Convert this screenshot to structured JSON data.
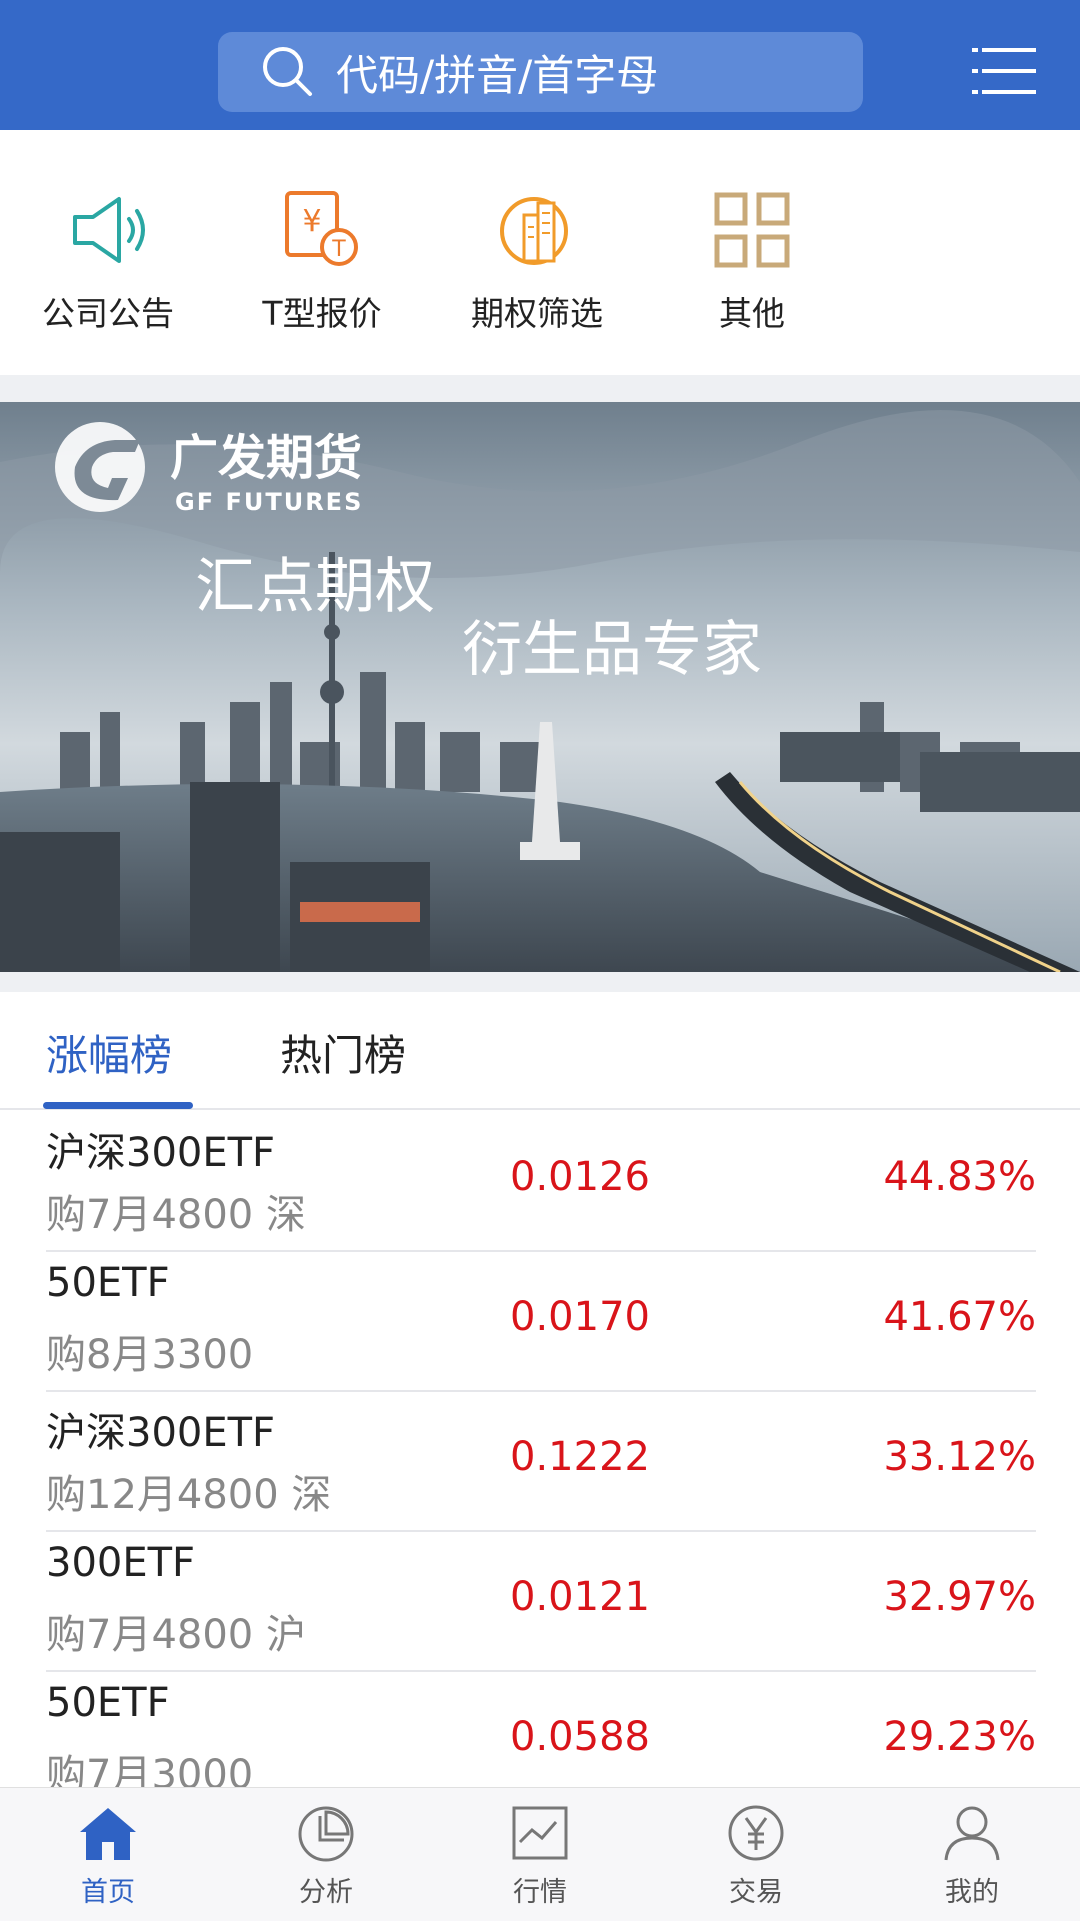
{
  "search": {
    "placeholder": "代码/拼音/首字母"
  },
  "quick_actions": [
    {
      "label": "公司公告",
      "icon": "announcement-speaker-icon"
    },
    {
      "label": "T型报价",
      "icon": "t-quote-icon"
    },
    {
      "label": "期权筛选",
      "icon": "option-filter-icon"
    },
    {
      "label": "其他",
      "icon": "grid-more-icon"
    }
  ],
  "banner": {
    "brand_cn": "广发期货",
    "brand_en": "GF FUTURES",
    "headline": "汇点期权",
    "subheadline": "衍生品专家"
  },
  "tabs": [
    {
      "label": "涨幅榜",
      "active": true
    },
    {
      "label": "热门榜",
      "active": false
    }
  ],
  "rows": [
    {
      "name": "沪深300ETF",
      "contract": "购7月4800 深",
      "price": "0.0126",
      "change": "44.83%"
    },
    {
      "name": "50ETF",
      "contract": "购8月3300",
      "price": "0.0170",
      "change": "41.67%"
    },
    {
      "name": "沪深300ETF",
      "contract": "购12月4800 深",
      "price": "0.1222",
      "change": "33.12%"
    },
    {
      "name": "300ETF",
      "contract": "购7月4800 沪",
      "price": "0.0121",
      "change": "32.97%"
    },
    {
      "name": "50ETF",
      "contract": "购7月3000",
      "price": "0.0588",
      "change": "29.23%"
    }
  ],
  "nav": [
    {
      "label": "首页",
      "icon": "home-icon",
      "active": true
    },
    {
      "label": "分析",
      "icon": "pie-chart-icon",
      "active": false
    },
    {
      "label": "行情",
      "icon": "line-chart-icon",
      "active": false
    },
    {
      "label": "交易",
      "icon": "yuan-icon",
      "active": false
    },
    {
      "label": "我的",
      "icon": "user-icon",
      "active": false
    }
  ],
  "colors": {
    "primary": "#3569c8",
    "accent": "#2f62c4",
    "up": "#d9141a"
  }
}
